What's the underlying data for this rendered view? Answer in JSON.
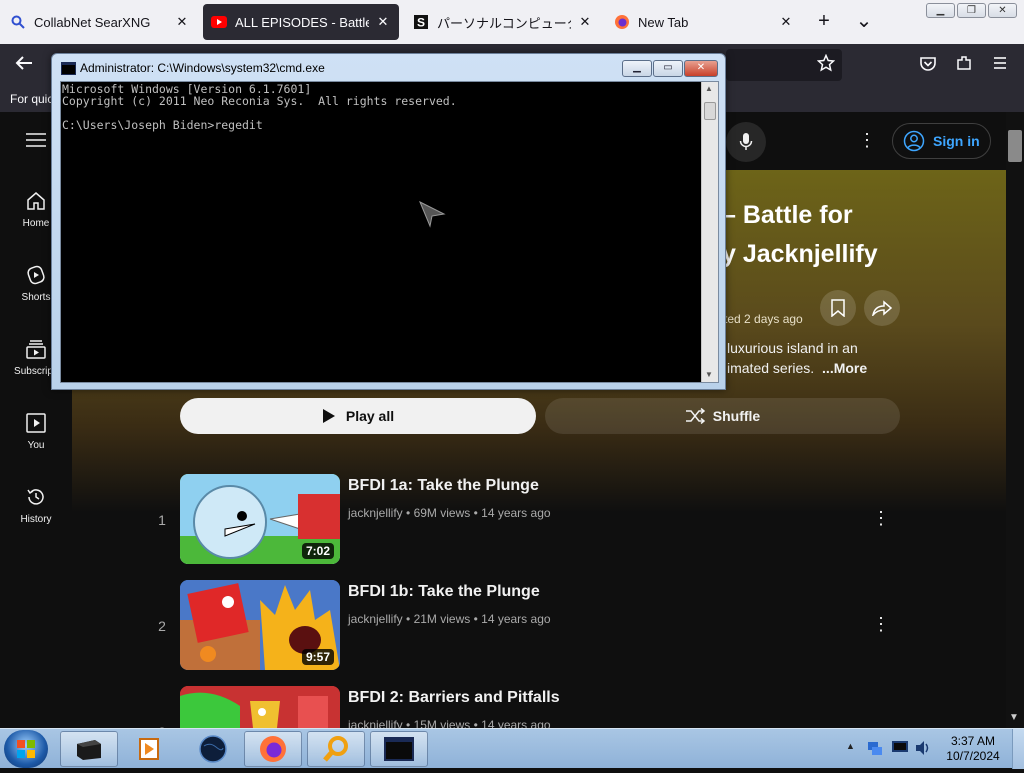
{
  "browser": {
    "tabs": [
      {
        "title": "CollabNet SearXNG",
        "icon": "search-icon",
        "close": "✕"
      },
      {
        "title": "ALL EPISODES - Battle for D",
        "icon": "youtube-icon",
        "close": "✕"
      },
      {
        "title": "パーソナルコンピューター",
        "icon": "s-icon",
        "close": "✕"
      },
      {
        "title": "New Tab",
        "icon": "firefox-icon",
        "close": "✕"
      }
    ],
    "new_tab": "+",
    "tab_list": "⌄",
    "bookmarks_label": "For quic"
  },
  "youtube": {
    "sign_in": "Sign in",
    "sidebar": [
      {
        "label": "Home",
        "icon": "home-icon"
      },
      {
        "label": "Shorts",
        "icon": "shorts-icon"
      },
      {
        "label": "Subscripti",
        "icon": "subscriptions-icon"
      },
      {
        "label": "You",
        "icon": "you-icon"
      },
      {
        "label": "History",
        "icon": "history-icon"
      }
    ],
    "hero": {
      "title_line1": "– Battle for",
      "title_line2": "y Jacknjellify",
      "updated": "ted 2 days ago",
      "desc_line1": "luxurious island in an",
      "desc_line2": "imated series.",
      "more": "...More"
    },
    "play_all": "Play all",
    "shuffle": "Shuffle",
    "videos": [
      {
        "num": "1",
        "title": "BFDI 1a: Take the Plunge",
        "channel": "jacknjellify",
        "views": "69M views",
        "age": "14 years ago",
        "duration": "7:02"
      },
      {
        "num": "2",
        "title": "BFDI 1b: Take the Plunge",
        "channel": "jacknjellify",
        "views": "21M views",
        "age": "14 years ago",
        "duration": "9:57"
      },
      {
        "num": "3",
        "title": "BFDI 2: Barriers and Pitfalls",
        "channel": "jacknjellify",
        "views": "15M views",
        "age": "14 years ago",
        "duration": ""
      }
    ],
    "separator": "•"
  },
  "cmd": {
    "title": "Administrator: C:\\Windows\\system32\\cmd.exe",
    "lines": [
      "Microsoft Windows [Version 6.1.7601]",
      "Copyright (c) 2011 Neo Reconia Sys.  All rights reserved.",
      "",
      "C:\\Users\\Joseph Biden>regedit"
    ]
  },
  "taskbar": {
    "time": "3:37 AM",
    "date": "10/7/2024",
    "show_hidden": "▲"
  },
  "colors": {
    "yt_bg": "#0f0f0f",
    "yt_blue": "#3ea6ff",
    "firefox_dark": "#2b2a33",
    "tab_strip": "#f0f0f4"
  }
}
